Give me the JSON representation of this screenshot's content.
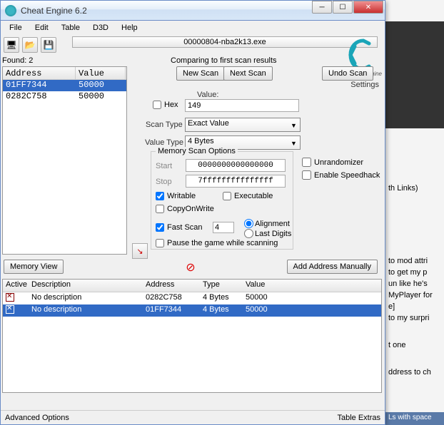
{
  "window": {
    "title": "Cheat Engine 6.2"
  },
  "menu": {
    "file": "File",
    "edit": "Edit",
    "table": "Table",
    "d3d": "D3D",
    "help": "Help"
  },
  "process": "00000804-nba2k13.exe",
  "logo_text": "Cheat Engine",
  "settings_link": "Settings",
  "found_label": "Found: 2",
  "results": {
    "col_address": "Address",
    "col_value": "Value",
    "rows": [
      {
        "addr": "01FF7344",
        "val": "50000"
      },
      {
        "addr": "0282C758",
        "val": "50000"
      }
    ]
  },
  "comparing_text": "Comparing to first scan results",
  "buttons": {
    "new_scan": "New Scan",
    "next_scan": "Next Scan",
    "undo_scan": "Undo Scan",
    "memory_view": "Memory View",
    "add_address": "Add Address Manually"
  },
  "labels": {
    "value": "Value:",
    "hex": "Hex",
    "scan_type": "Scan Type",
    "value_type": "Value Type",
    "mem_options": "Memory Scan Options",
    "start": "Start",
    "stop": "Stop",
    "writable": "Writable",
    "executable": "Executable",
    "copyonwrite": "CopyOnWrite",
    "fast_scan": "Fast Scan",
    "alignment": "Alignment",
    "last_digits": "Last Digits",
    "pause_game": "Pause the game while scanning",
    "unrandomizer": "Unrandomizer",
    "speedhack": "Enable Speedhack"
  },
  "inputs": {
    "value": "149",
    "scan_type": "Exact Value",
    "value_type": "4 Bytes",
    "start": "0000000000000000",
    "stop": "7fffffffffffffff",
    "fast_scan": "4"
  },
  "cheatlist": {
    "cols": {
      "active": "Active",
      "desc": "Description",
      "addr": "Address",
      "type": "Type",
      "value": "Value"
    },
    "rows": [
      {
        "desc": "No description",
        "addr": "0282C758",
        "type": "4 Bytes",
        "val": "50000"
      },
      {
        "desc": "No description",
        "addr": "01FF7344",
        "type": "4 Bytes",
        "val": "50000"
      }
    ]
  },
  "statusbar": {
    "adv": "Advanced Options",
    "tbl": "Table Extras"
  },
  "bg": {
    "links_title": "th Links)",
    "lines": [
      "to mod attri",
      "to get my p",
      "un like he's",
      "MyPlayer for",
      "e]",
      "to my surpri",
      "t one",
      "ddress to ch"
    ],
    "status": "Ls with space"
  }
}
